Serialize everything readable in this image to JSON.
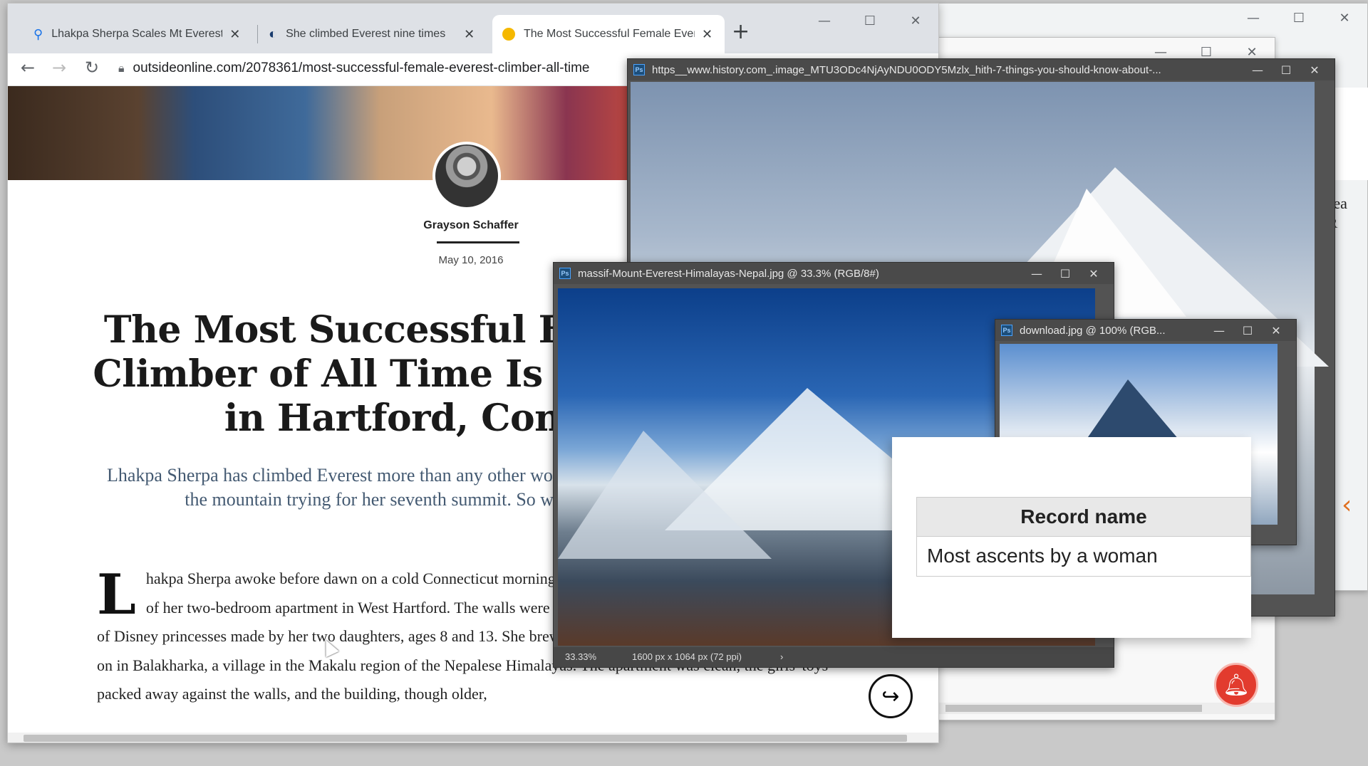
{
  "browser": {
    "tabs": [
      {
        "title": "Lhakpa Sherpa Scales Mt Everest",
        "icon": "location-pin-icon"
      },
      {
        "title": "She climbed Everest nine times",
        "icon": "globe-icon"
      },
      {
        "title": "The Most Successful Female Everest",
        "icon": "outside-logo-icon",
        "active": true
      }
    ],
    "url": "outsideonline.com/2078361/most-successful-female-everest-climber-all-time"
  },
  "article": {
    "author": "Grayson Schaffer",
    "date": "May 10, 2016",
    "headline": "The Most Successful Female Everest Climber of All Time Is a Housekeeper in Hartford, Connecticut",
    "dek": "Lhakpa Sherpa has climbed Everest more than any other woman in the world. She's headed back to the mountain trying for her seventh summit. So why haven't you heard of her?",
    "dropcap": "L",
    "body": "hakpa Sherpa awoke before dawn on a cold Connecticut morning this past winter. She shuffled into the kitchen of her two-bedroom apartment in West Hartford. The walls were covered in drawings and coloring-book pages of Disney princesses made by her two daughters, ages 8 and 13. She brewed up a small pot of tea, the way she grew up on in Balakharka, a village in the Makalu region of the Nepalese Himalayas. The apartment was clean, the girls' toys packed away against the walls, and the building, though older,"
  },
  "ps_windows": {
    "history": "https__www.history.com_.image_MTU3ODc4NjAyNDU0ODY5Mzlx_hith-7-things-you-should-know-about-...",
    "massif": "massif-Mount-Everest-Himalayas-Nepal.jpg @ 33.3% (RGB/8#)",
    "download": "download.jpg @ 100% (RGB...",
    "status_zoom": "33.33%",
    "status_size": "1600 px x 1064 px (72 ppi)"
  },
  "record": {
    "header": "Record name",
    "value": "Most ascents by a woman"
  },
  "back_window": {
    "partial_text_1": "rea",
    "partial_text_2": "R"
  }
}
